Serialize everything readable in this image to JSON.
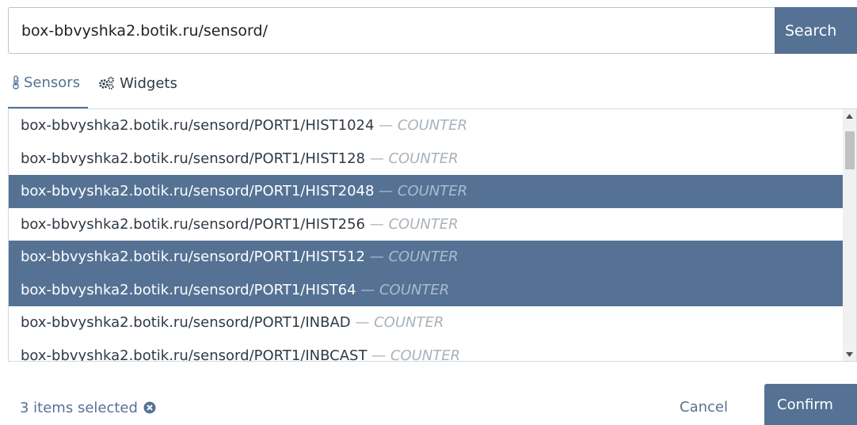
{
  "search": {
    "value": "box-bbvyshka2.botik.ru/sensord/",
    "button_label": "Search"
  },
  "tabs": [
    {
      "label": "Sensors",
      "icon": "thermometer-icon",
      "active": true
    },
    {
      "label": "Widgets",
      "icon": "gears-icon",
      "active": false
    }
  ],
  "sensors": [
    {
      "path": "box-bbvyshka2.botik.ru/sensord/PORT1/HIST1024",
      "separator": " — ",
      "type": "COUNTER",
      "selected": false
    },
    {
      "path": "box-bbvyshka2.botik.ru/sensord/PORT1/HIST128",
      "separator": " — ",
      "type": "COUNTER",
      "selected": false
    },
    {
      "path": "box-bbvyshka2.botik.ru/sensord/PORT1/HIST2048",
      "separator": " — ",
      "type": "COUNTER",
      "selected": true
    },
    {
      "path": "box-bbvyshka2.botik.ru/sensord/PORT1/HIST256",
      "separator": " — ",
      "type": "COUNTER",
      "selected": false
    },
    {
      "path": "box-bbvyshka2.botik.ru/sensord/PORT1/HIST512",
      "separator": " — ",
      "type": "COUNTER",
      "selected": true
    },
    {
      "path": "box-bbvyshka2.botik.ru/sensord/PORT1/HIST64",
      "separator": " — ",
      "type": "COUNTER",
      "selected": true
    },
    {
      "path": "box-bbvyshka2.botik.ru/sensord/PORT1/INBAD",
      "separator": " — ",
      "type": "COUNTER",
      "selected": false
    },
    {
      "path": "box-bbvyshka2.botik.ru/sensord/PORT1/INBCAST",
      "separator": " — ",
      "type": "COUNTER",
      "selected": false
    }
  ],
  "footer": {
    "selected_text": "3 items selected",
    "clear_icon": "times-circle-icon",
    "cancel_label": "Cancel",
    "confirm_label": "Confirm"
  },
  "colors": {
    "accent": "#557294",
    "selected_row_bg": "#557294",
    "muted_type": "#a8b2bb"
  }
}
